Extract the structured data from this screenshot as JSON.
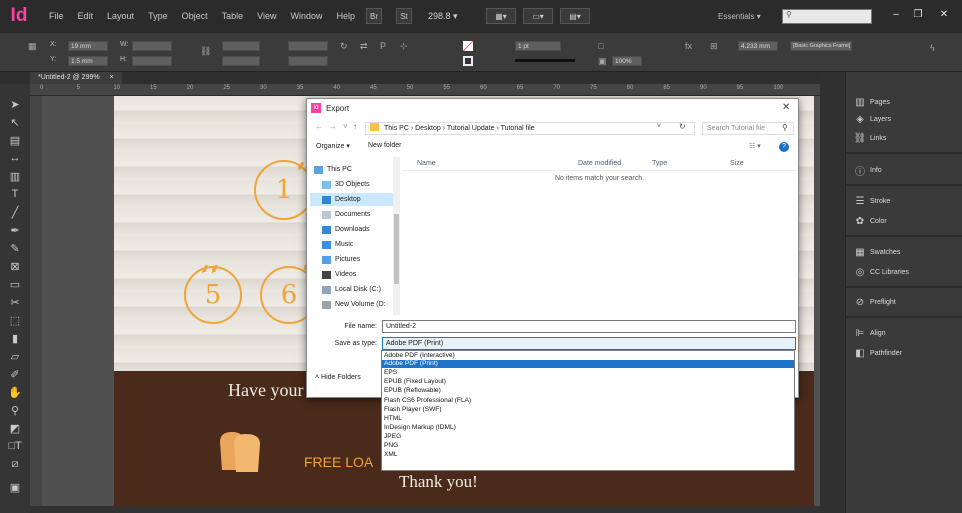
{
  "app": {
    "logo": "Id",
    "menu": [
      "File",
      "Edit",
      "Layout",
      "Type",
      "Object",
      "Table",
      "View",
      "Window",
      "Help"
    ],
    "br_badge": "Br",
    "st_badge": "St",
    "zoom": "298.8",
    "workspace": "Essentials",
    "win_min": "–",
    "win_max": "❐",
    "win_close": "✕"
  },
  "control": {
    "x_value": "19 mm",
    "y_value": "1.5 mm",
    "stroke_weight": "1 pt",
    "opacity": "100%",
    "width_value": "4.233 mm",
    "frame_style": "[Basic Graphics Frame]"
  },
  "document": {
    "tab_title": "*Untitled-2 @ 299%",
    "tab_close": "×",
    "ruler_ticks": [
      "0",
      "5",
      "10",
      "15",
      "20",
      "25",
      "30",
      "35",
      "40",
      "45",
      "50",
      "55",
      "60",
      "65",
      "70",
      "75",
      "80",
      "85",
      "90",
      "95",
      "100"
    ],
    "circle_1": "1",
    "circle_5": "5",
    "circle_6": "6",
    "card_text": "Have your card st",
    "free_text": "FREE LOA",
    "thanks_text": "Thank you!"
  },
  "panels": [
    {
      "name": "Pages",
      "icon": "pages-icon"
    },
    {
      "name": "Layers",
      "icon": "layers-icon"
    },
    {
      "name": "Links",
      "icon": "links-icon"
    },
    {
      "name": "Info",
      "icon": "info-icon"
    },
    {
      "name": "Stroke",
      "icon": "stroke-icon"
    },
    {
      "name": "Color",
      "icon": "color-icon"
    },
    {
      "name": "Swatches",
      "icon": "swatches-icon"
    },
    {
      "name": "CC Libraries",
      "icon": "cc-libraries-icon"
    },
    {
      "name": "Preflight",
      "icon": "preflight-icon"
    },
    {
      "name": "Align",
      "icon": "align-icon"
    },
    {
      "name": "Pathfinder",
      "icon": "pathfinder-icon"
    }
  ],
  "dialog": {
    "title": "Export",
    "close": "✕",
    "path": "This PC  ›  Desktop  ›  Tutorial Update  ›  Tutorial file",
    "search_placeholder": "Search Tutorial file",
    "organize": "Organize ▾",
    "new_folder": "New folder",
    "help": "?",
    "nav_items": [
      "This PC",
      "3D Objects",
      "Desktop",
      "Documents",
      "Downloads",
      "Music",
      "Pictures",
      "Videos",
      "Local Disk (C:)",
      "New Volume (D:"
    ],
    "columns": [
      "Name",
      "Date modified",
      "Type",
      "Size"
    ],
    "empty_message": "No items match your search.",
    "file_name_label": "File name:",
    "file_name_value": "Untitled-2",
    "save_as_label": "Save as type:",
    "save_as_value": "Adobe PDF (Print)",
    "hide_folders": "˄  Hide Folders",
    "type_options": [
      "Adobe PDF (Interactive)",
      "Adobe PDF (Print)",
      "EPS",
      "EPUB (Fixed Layout)",
      "EPUB (Reflowable)",
      "Flash CS6 Professional (FLA)",
      "Flash Player (SWF)",
      "HTML",
      "InDesign Markup (IDML)",
      "JPEG",
      "PNG",
      "XML"
    ],
    "selected_option": 1
  },
  "colors": {
    "accent": "#1f73c8",
    "indesign_pink": "#ff3fa4",
    "orange": "#f0a43a",
    "brown": "#4a2a1a"
  }
}
